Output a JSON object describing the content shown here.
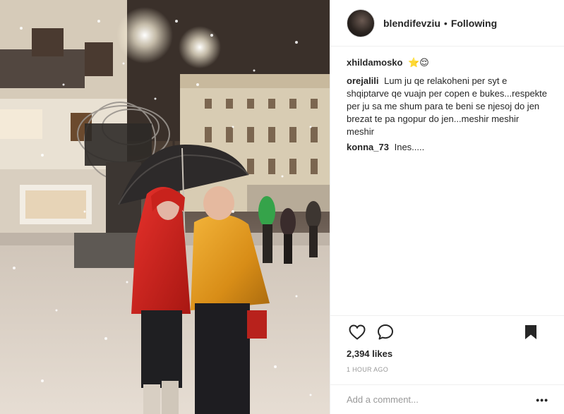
{
  "post": {
    "photo_icon": "post-photo"
  },
  "header": {
    "username": "blendifevziu",
    "separator": "•",
    "follow_state": "Following"
  },
  "caption": {
    "author": "xhildamosko",
    "text": "⭐😌"
  },
  "comments": [
    {
      "author": "orejalili",
      "text": "Lum ju qe relakoheni per syt e shqiptarve qe vuajn per copen e bukes...respekte per ju sa me shum para te beni se njesoj do jen brezat te pa ngopur do jen...meshir meshir meshir"
    },
    {
      "author": "konna_73",
      "text": "Ines....."
    }
  ],
  "actions": {
    "like_icon": "heart-icon",
    "comment_icon": "comment-icon",
    "save_icon": "bookmark-icon"
  },
  "likes": "2,394 likes",
  "timestamp": "1 HOUR AGO",
  "add_comment": {
    "placeholder": "Add a comment...",
    "more_label": "•••"
  }
}
